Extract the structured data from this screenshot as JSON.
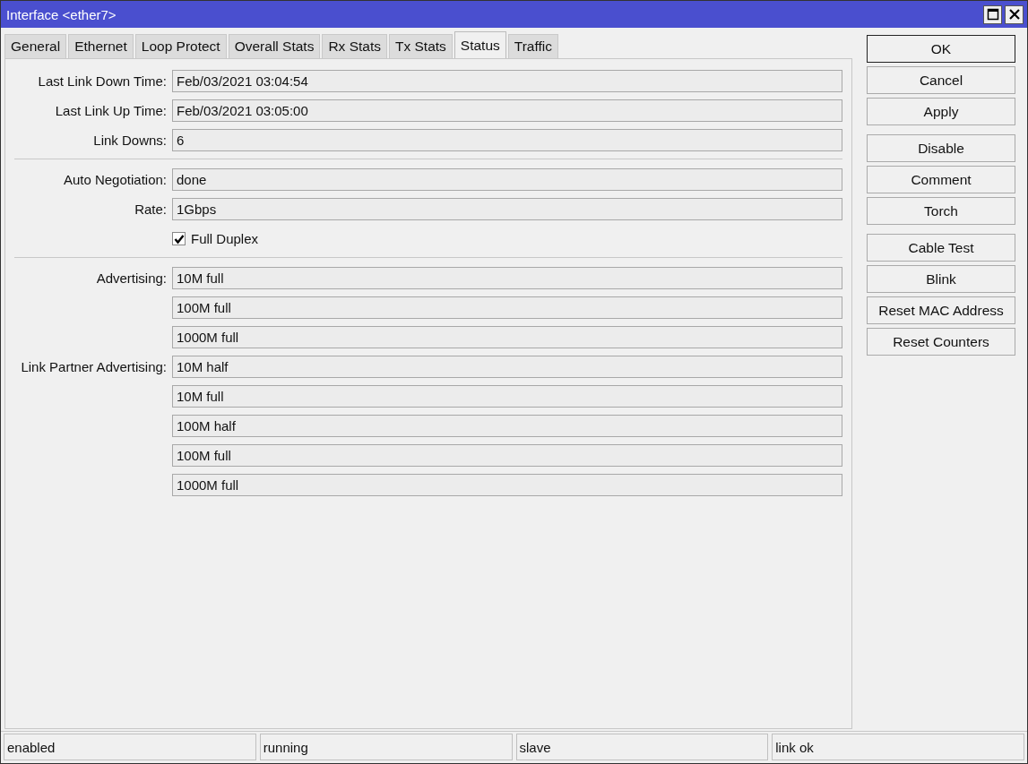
{
  "window": {
    "title": "Interface <ether7>"
  },
  "tabs": [
    {
      "label": "General",
      "selected": false
    },
    {
      "label": "Ethernet",
      "selected": false
    },
    {
      "label": "Loop Protect",
      "selected": false
    },
    {
      "label": "Overall Stats",
      "selected": false
    },
    {
      "label": "Rx Stats",
      "selected": false
    },
    {
      "label": "Tx Stats",
      "selected": false
    },
    {
      "label": "Status",
      "selected": true
    },
    {
      "label": "Traffic",
      "selected": false
    }
  ],
  "sections": [
    {
      "rows": [
        {
          "kind": "field",
          "label": "Last Link Down Time:",
          "value": "Feb/03/2021 03:04:54"
        },
        {
          "kind": "field",
          "label": "Last Link Up Time:",
          "value": "Feb/03/2021 03:05:00"
        },
        {
          "kind": "field",
          "label": "Link Downs:",
          "value": "6"
        }
      ]
    },
    {
      "rows": [
        {
          "kind": "field",
          "label": "Auto Negotiation:",
          "value": "done"
        },
        {
          "kind": "field",
          "label": "Rate:",
          "value": "1Gbps"
        },
        {
          "kind": "checkbox",
          "label": "Full Duplex",
          "checked": true
        }
      ]
    },
    {
      "rows": [
        {
          "kind": "field",
          "label": "Advertising:",
          "value": "10M full"
        },
        {
          "kind": "field",
          "value": "100M full"
        },
        {
          "kind": "field",
          "value": "1000M full"
        },
        {
          "kind": "field",
          "label": "Link Partner Advertising:",
          "value": "10M half"
        },
        {
          "kind": "field",
          "value": "10M full"
        },
        {
          "kind": "field",
          "value": "100M half"
        },
        {
          "kind": "field",
          "value": "100M full"
        },
        {
          "kind": "field",
          "value": "1000M full"
        }
      ]
    }
  ],
  "button_groups": [
    [
      {
        "label": "OK",
        "default": true
      },
      {
        "label": "Cancel",
        "default": false
      },
      {
        "label": "Apply",
        "default": false
      }
    ],
    [
      {
        "label": "Disable",
        "default": false
      },
      {
        "label": "Comment",
        "default": false
      },
      {
        "label": "Torch",
        "default": false
      }
    ],
    [
      {
        "label": "Cable Test",
        "default": false
      },
      {
        "label": "Blink",
        "default": false
      },
      {
        "label": "Reset MAC Address",
        "default": false
      },
      {
        "label": "Reset Counters",
        "default": false
      }
    ]
  ],
  "status_bar": [
    "enabled",
    "running",
    "slave",
    "link ok"
  ]
}
